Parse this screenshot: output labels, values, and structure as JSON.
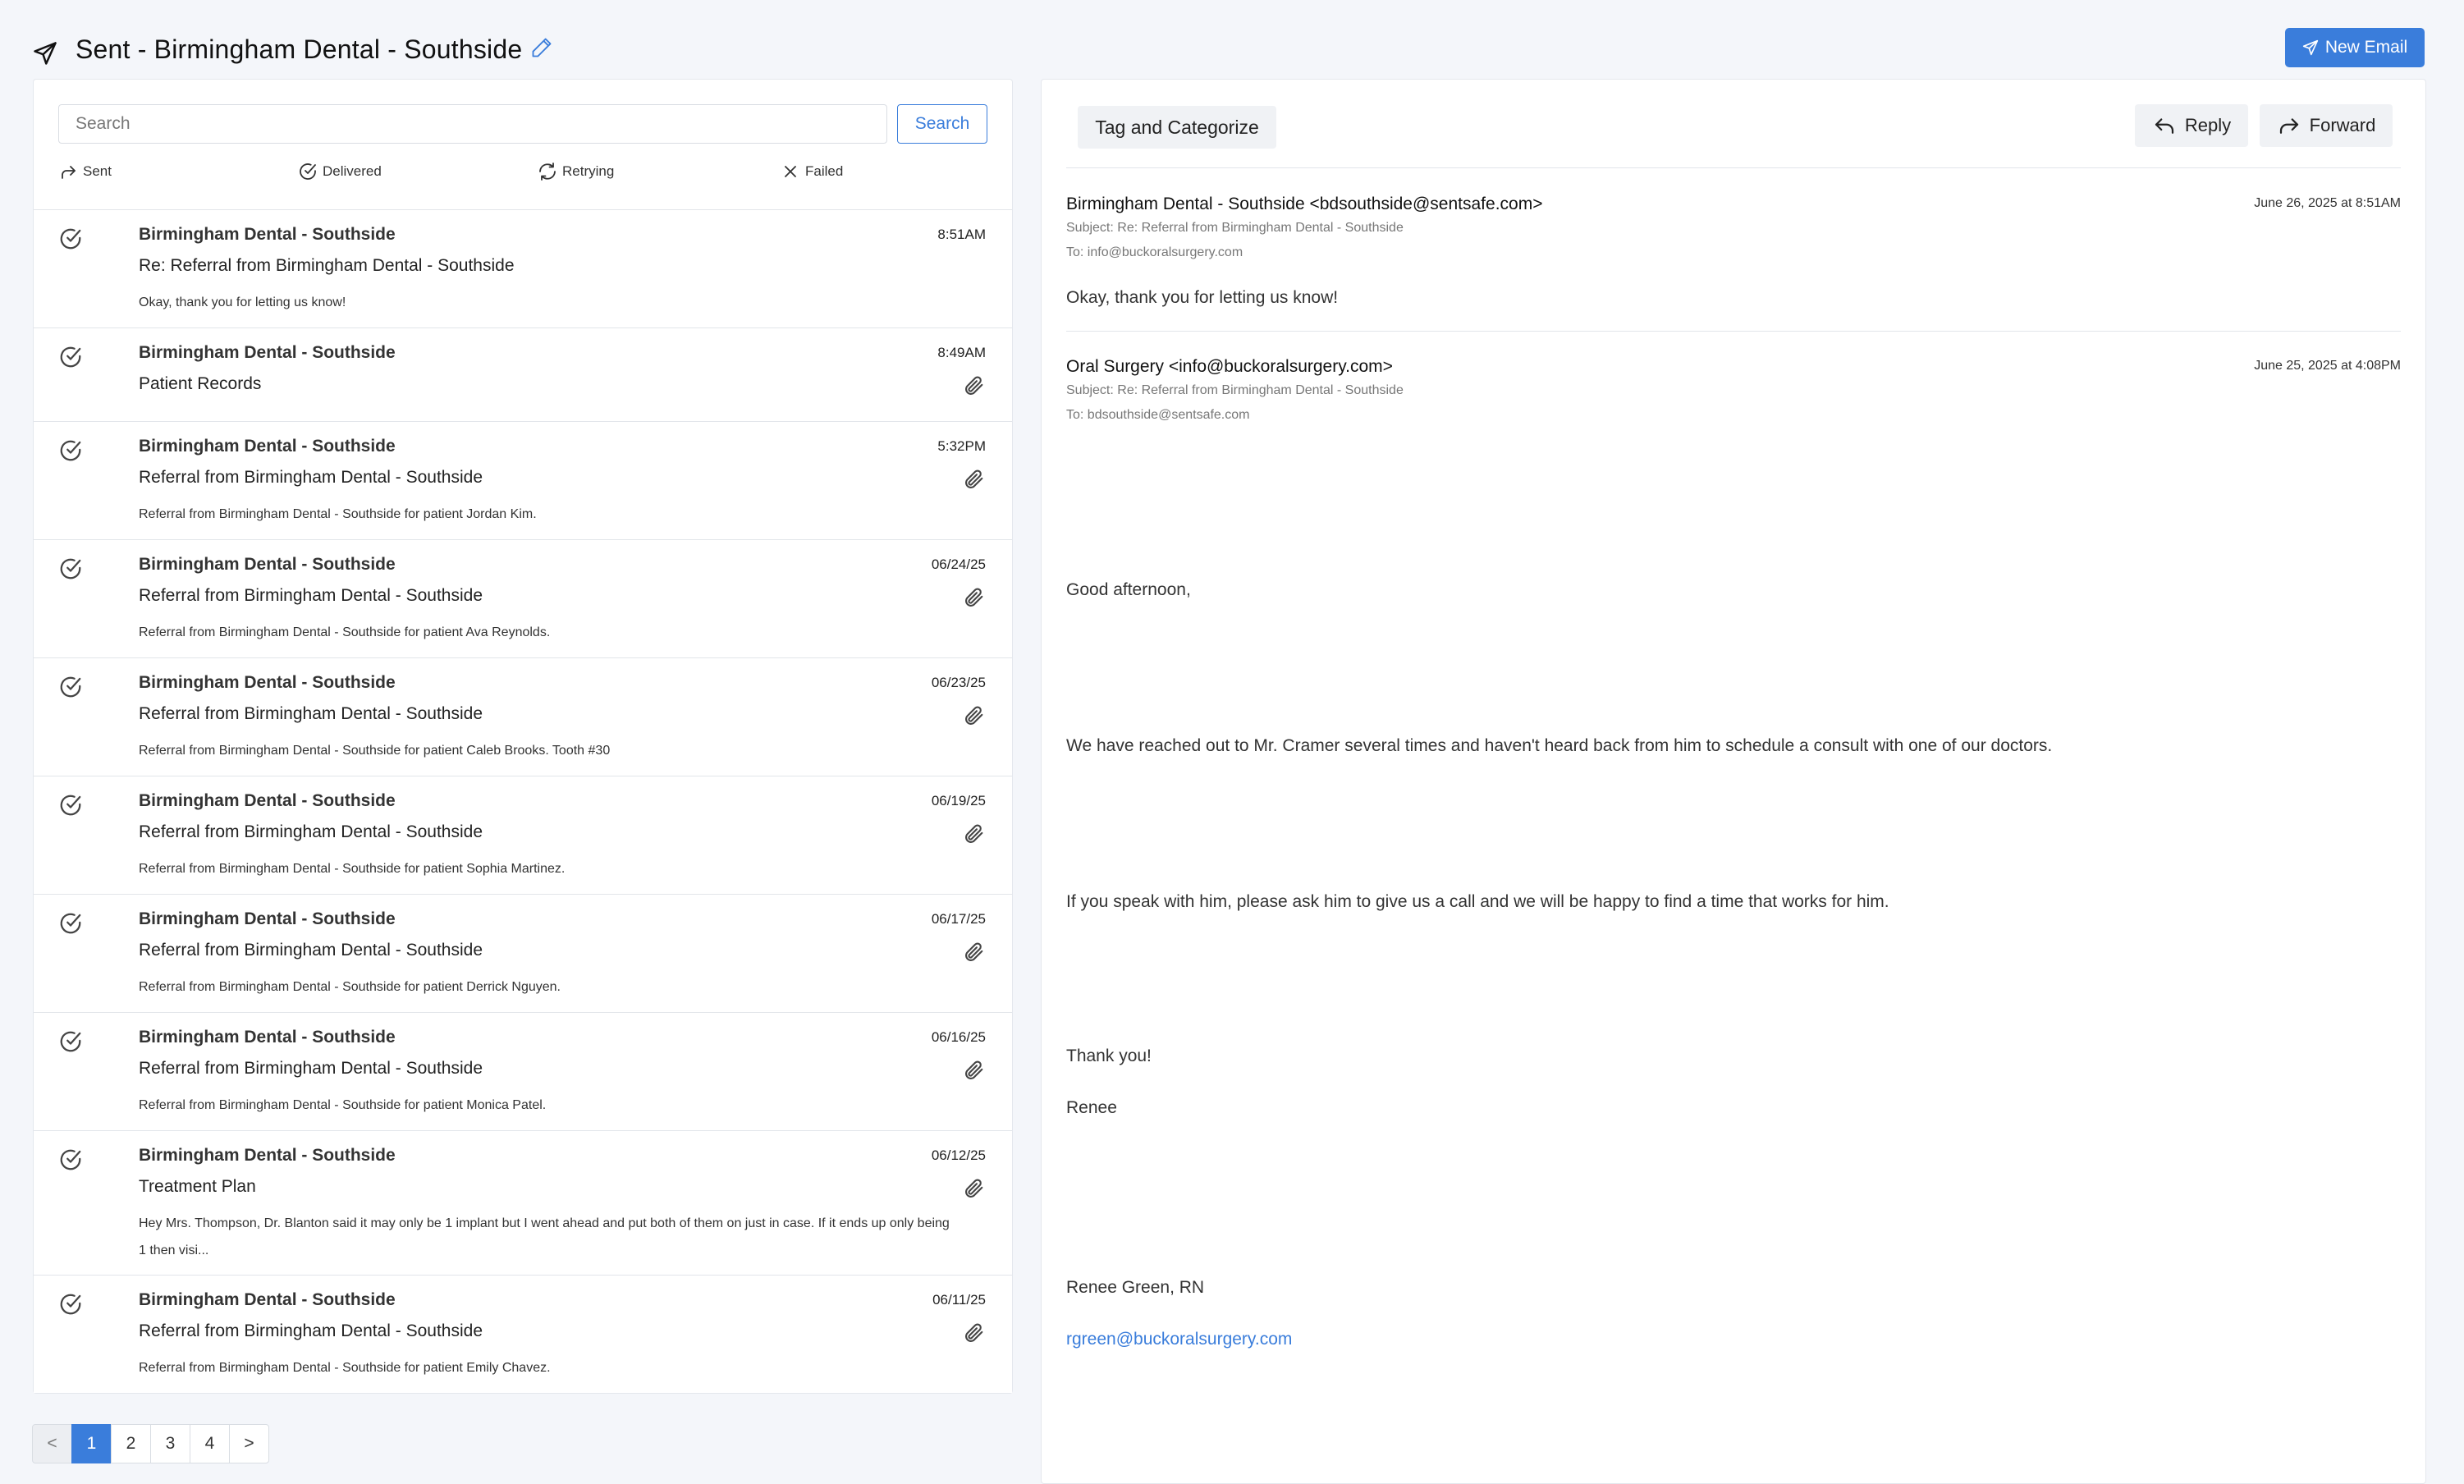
{
  "header": {
    "title": "Sent - Birmingham Dental - Southside",
    "new_email_label": "New Email"
  },
  "search": {
    "placeholder": "Search",
    "button_label": "Search"
  },
  "filters": [
    "Sent",
    "Delivered",
    "Retrying",
    "Failed"
  ],
  "emails": [
    {
      "sender": "Birmingham Dental - Southside",
      "subject": "Re: Referral from Birmingham Dental - Southside",
      "preview": "Okay, thank you for letting us know!",
      "time": "8:51AM",
      "attachment": false
    },
    {
      "sender": "Birmingham Dental - Southside",
      "subject": "Patient Records",
      "preview": "",
      "time": "8:49AM",
      "attachment": true
    },
    {
      "sender": "Birmingham Dental - Southside",
      "subject": "Referral from Birmingham Dental - Southside",
      "preview": "Referral from Birmingham Dental - Southside for patient Jordan Kim.",
      "time": "5:32PM",
      "attachment": true
    },
    {
      "sender": "Birmingham Dental - Southside",
      "subject": "Referral from Birmingham Dental - Southside",
      "preview": "Referral from Birmingham Dental - Southside for patient Ava Reynolds.",
      "time": "06/24/25",
      "attachment": true
    },
    {
      "sender": "Birmingham Dental - Southside",
      "subject": "Referral from Birmingham Dental - Southside",
      "preview": "Referral from Birmingham Dental - Southside for patient Caleb Brooks. Tooth #30",
      "time": "06/23/25",
      "attachment": true
    },
    {
      "sender": "Birmingham Dental - Southside",
      "subject": "Referral from Birmingham Dental - Southside",
      "preview": "Referral from Birmingham Dental - Southside for patient Sophia Martinez.",
      "time": "06/19/25",
      "attachment": true
    },
    {
      "sender": "Birmingham Dental - Southside",
      "subject": "Referral from Birmingham Dental - Southside",
      "preview": "Referral from Birmingham Dental - Southside for patient Derrick Nguyen.",
      "time": "06/17/25",
      "attachment": true
    },
    {
      "sender": "Birmingham Dental - Southside",
      "subject": "Referral from Birmingham Dental - Southside",
      "preview": "Referral from Birmingham Dental - Southside for patient Monica Patel.",
      "time": "06/16/25",
      "attachment": true
    },
    {
      "sender": "Birmingham Dental - Southside",
      "subject": "Treatment Plan",
      "preview": "Hey Mrs. Thompson, Dr. Blanton said it may only be 1 implant but I went ahead and put both of them on just in case. If it ends up only being 1 then visi...",
      "time": "06/12/25",
      "attachment": true
    },
    {
      "sender": "Birmingham Dental - Southside",
      "subject": "Referral from Birmingham Dental - Southside",
      "preview": "Referral from Birmingham Dental - Southside for patient Emily Chavez.",
      "time": "06/11/25",
      "attachment": true
    }
  ],
  "pagination": {
    "prev": "<",
    "pages": [
      "1",
      "2",
      "3",
      "4"
    ],
    "next": ">",
    "current": "1"
  },
  "detail": {
    "tag_label": "Tag and Categorize",
    "reply_label": "Reply",
    "forward_label": "Forward",
    "messages": [
      {
        "from": "Birmingham Dental - Southside <bdsouthside@sentsafe.com>",
        "date": "June 26, 2025 at 8:51AM",
        "subject": "Subject: Re: Referral from Birmingham Dental - Southside",
        "to": "To: info@buckoralsurgery.com",
        "body": "Okay, thank you for letting us know!"
      },
      {
        "from": "Oral Surgery <info@buckoralsurgery.com>",
        "date": "June 25, 2025 at 4:08PM",
        "subject": "Subject: Re: Referral from Birmingham Dental - Southside",
        "to": "To: bdsouthside@sentsafe.com",
        "body": [
          "Good afternoon,",
          "We have reached out to Mr. Cramer several times and haven't heard back from him to schedule a consult with one of our doctors.",
          "If you speak with him, please ask him to give us a call and we will be happy to find a time that works for him.",
          "Thank you!",
          "Renee",
          "Renee Green, RN"
        ],
        "link": "rgreen@buckoralsurgery.com"
      }
    ]
  },
  "colors": {
    "accent": "#3a7ddb",
    "background": "#f4f6fa",
    "panel": "#ffffff",
    "muted_text": "#777777"
  }
}
